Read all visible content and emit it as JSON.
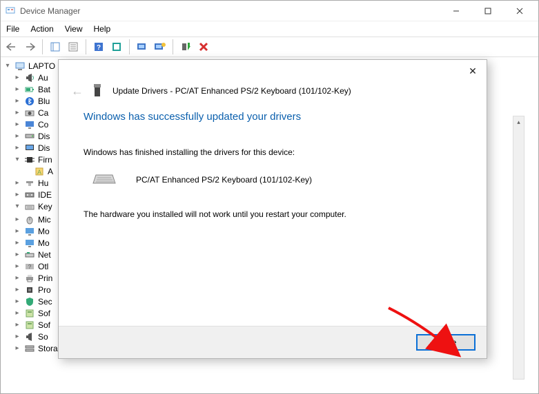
{
  "window": {
    "title": "Device Manager",
    "menus": [
      "File",
      "Action",
      "View",
      "Help"
    ]
  },
  "toolbar_icons": [
    "back",
    "forward",
    "panel",
    "list",
    "help",
    "teal-square",
    "monitor",
    "monitor-star",
    "green-arrow",
    "red-x"
  ],
  "tree": {
    "root_label": "LAPTO",
    "items": [
      {
        "label": "Au",
        "icon": "speaker"
      },
      {
        "label": "Bat",
        "icon": "battery"
      },
      {
        "label": "Blu",
        "icon": "bluetooth"
      },
      {
        "label": "Ca",
        "icon": "camera"
      },
      {
        "label": "Co",
        "icon": "monitor"
      },
      {
        "label": "Dis",
        "icon": "disk"
      },
      {
        "label": "Dis",
        "icon": "display"
      },
      {
        "label": "Firn",
        "icon": "chip",
        "expanded": true,
        "child": "A"
      },
      {
        "label": "Hu",
        "icon": "hid"
      },
      {
        "label": "IDE",
        "icon": "ide"
      },
      {
        "label": "Key",
        "icon": "keyboard",
        "expanded": true
      },
      {
        "label": "Mic",
        "icon": "mouse"
      },
      {
        "label": "Mo",
        "icon": "monitor2"
      },
      {
        "label": "Mo",
        "icon": "monitor2"
      },
      {
        "label": "Net",
        "icon": "net"
      },
      {
        "label": "Otl",
        "icon": "other"
      },
      {
        "label": "Prin",
        "icon": "printer"
      },
      {
        "label": "Pro",
        "icon": "cpu"
      },
      {
        "label": "Sec",
        "icon": "sec"
      },
      {
        "label": "Sof",
        "icon": "soft"
      },
      {
        "label": "Sof",
        "icon": "soft"
      },
      {
        "label": "So",
        "icon": "sound"
      },
      {
        "label": "Storage controllers",
        "icon": "storage"
      }
    ]
  },
  "dialog": {
    "title": "Update Drivers - PC/AT Enhanced PS/2 Keyboard (101/102-Key)",
    "headline": "Windows has successfully updated your drivers",
    "line1": "Windows has finished installing the drivers for this device:",
    "device_name": "PC/AT Enhanced PS/2 Keyboard (101/102-Key)",
    "line2": "The hardware you installed will not work until you restart your computer.",
    "close_btn": "Close"
  }
}
